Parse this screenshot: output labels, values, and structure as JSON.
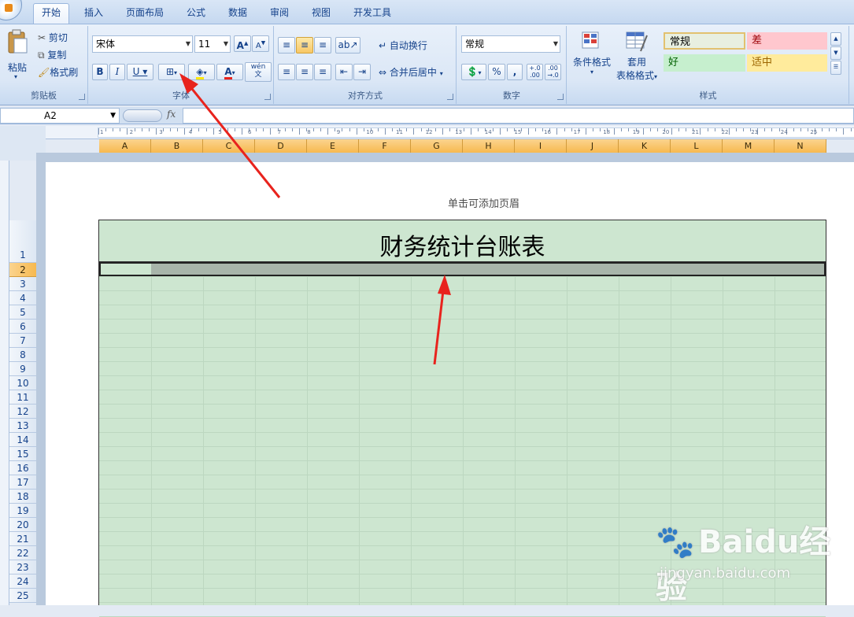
{
  "tabs": [
    "开始",
    "插入",
    "页面布局",
    "公式",
    "数据",
    "审阅",
    "视图",
    "开发工具"
  ],
  "active_tab": "开始",
  "clipboard": {
    "label": "剪贴板",
    "paste": "粘贴",
    "cut": "剪切",
    "copy": "复制",
    "format_painter": "格式刷"
  },
  "font": {
    "label": "字体",
    "name": "宋体",
    "size": "11",
    "bold": "B",
    "italic": "I",
    "underline": "U",
    "pinyin": "wén\n文"
  },
  "alignment": {
    "label": "对齐方式",
    "wrap_text": "自动换行",
    "merge_center": "合并后居中"
  },
  "number": {
    "label": "数字",
    "format": "常规",
    "percent": "%",
    "comma": ",",
    "inc_decimal": "+.0\n.00",
    "dec_decimal": ".00\n→.0"
  },
  "styles": {
    "label": "样式",
    "conditional": "条件格式",
    "table_format_1": "套用",
    "table_format_2": "表格格式",
    "normal": "常规",
    "bad": "差",
    "good": "好",
    "neutral": "适中"
  },
  "formula_bar": {
    "name_box": "A2",
    "fx": "fx"
  },
  "columns": [
    "A",
    "B",
    "C",
    "D",
    "E",
    "F",
    "G",
    "H",
    "I",
    "J",
    "K",
    "L",
    "M",
    "N"
  ],
  "rows": [
    "1",
    "2",
    "3",
    "4",
    "5",
    "6",
    "7",
    "8",
    "9",
    "10",
    "11",
    "12",
    "13",
    "14",
    "15",
    "16",
    "17",
    "18",
    "19",
    "20",
    "21",
    "22",
    "23",
    "24",
    "25"
  ],
  "ruler_numbers": [
    "1",
    "2",
    "3",
    "4",
    "5",
    "6",
    "7",
    "8",
    "9",
    "10",
    "11",
    "12",
    "13",
    "14",
    "15",
    "16",
    "17",
    "18",
    "19",
    "20",
    "21",
    "22",
    "23",
    "24",
    "25"
  ],
  "page": {
    "header_hint": "单击可添加页眉",
    "title": "财务统计台账表"
  },
  "watermark": {
    "brand": "Baidu经验",
    "url": "jingyan.baidu.com"
  },
  "colors": {
    "sheet_fill": "#cde6d0",
    "selection_fill": "#a8b5aa",
    "arrow": "#e8231d",
    "header_highlight": "#f7b94f"
  }
}
